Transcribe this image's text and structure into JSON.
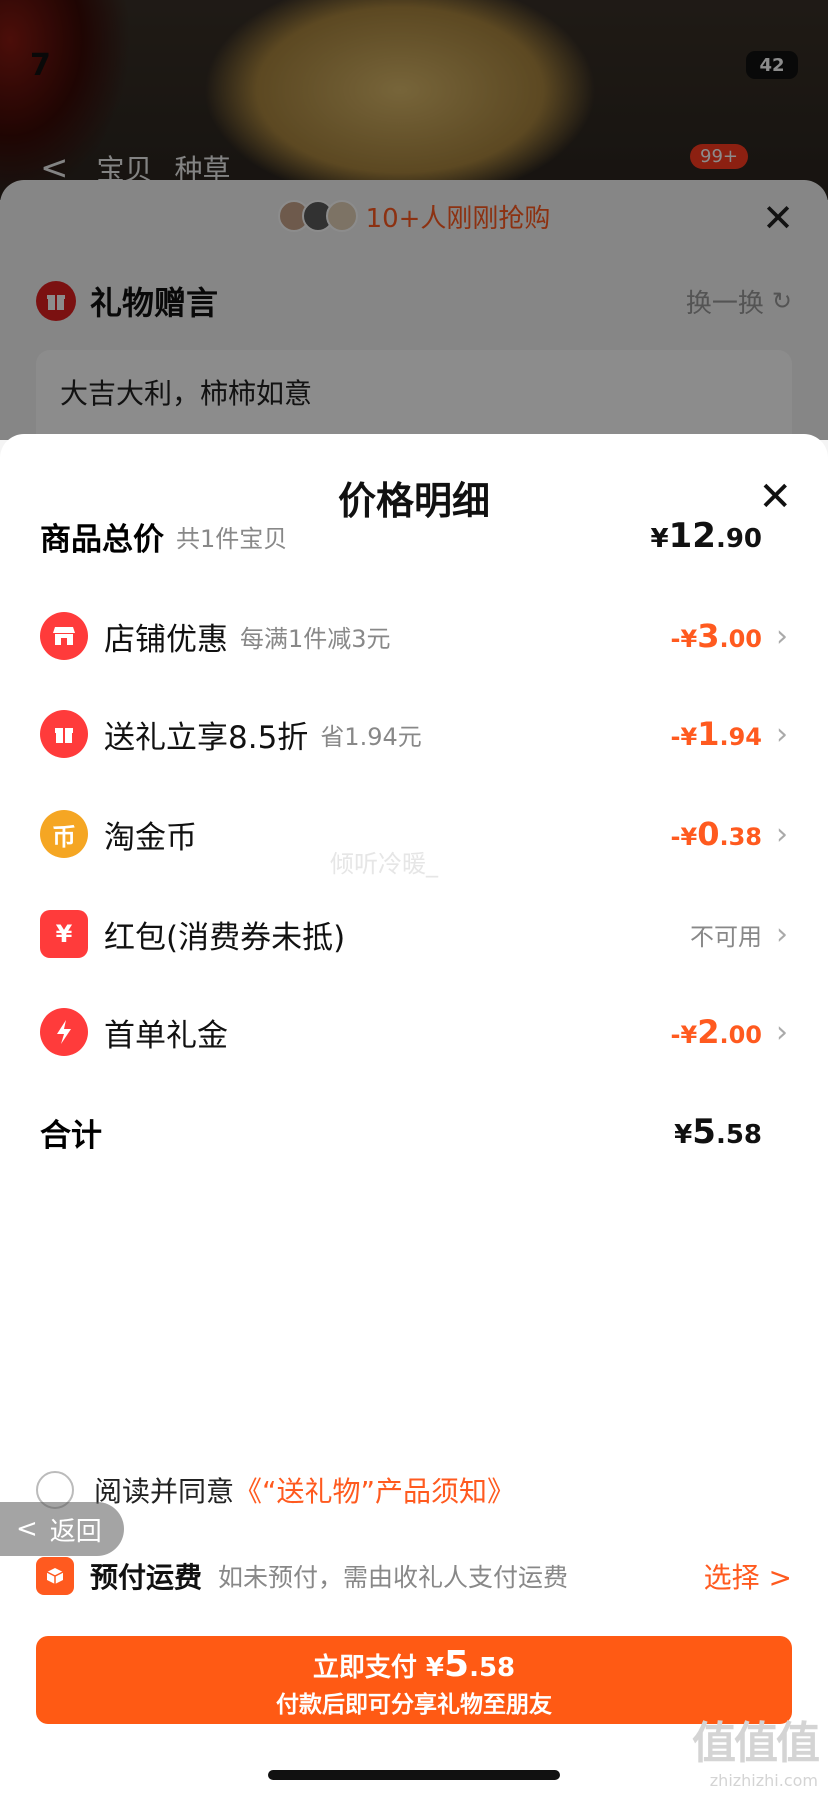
{
  "background": {
    "status_time": "7",
    "battery": "42",
    "nav": {
      "back": "<",
      "tabs": [
        "宝贝",
        "种草"
      ],
      "cart_badge": "99+"
    }
  },
  "gift_sheet": {
    "buyers_text": "10+人刚刚抢购",
    "close": "✕",
    "gift_title": "礼物赠言",
    "swap_label": "换一换",
    "message": "大吉大利，柿柿如意"
  },
  "price_detail": {
    "title": "价格明细",
    "close": "✕",
    "total": {
      "label": "商品总价",
      "sub": "共1件宝贝",
      "currency": "¥",
      "int": "12",
      "dec": ".90"
    },
    "rows": [
      {
        "icon": "store-icon",
        "name": "店铺优惠",
        "sub": "每满1件减3元",
        "sign": "-¥",
        "int": "3",
        "dec": ".00",
        "color": "#ff3b3b"
      },
      {
        "icon": "gift-icon",
        "name": "送礼立享8.5折",
        "sub": "省1.94元",
        "sign": "-¥",
        "int": "1",
        "dec": ".94",
        "color": "#ff3b3b"
      },
      {
        "icon": "coin-icon",
        "name": "淘金币",
        "sub": "",
        "sign": "-¥",
        "int": "0",
        "dec": ".38",
        "color": "#f5a623"
      },
      {
        "icon": "red-packet-icon",
        "name": "红包(消费券未抵)",
        "sub": "",
        "status": "不可用",
        "color": "#ff3b3b"
      },
      {
        "icon": "lightning-icon",
        "name": "首单礼金",
        "sub": "",
        "sign": "-¥",
        "int": "2",
        "dec": ".00",
        "color": "#ff3b3b"
      }
    ],
    "sum": {
      "label": "合计",
      "currency": "¥",
      "int": "5",
      "dec": ".58"
    },
    "watermark": "倾听冷暖_"
  },
  "agreement": {
    "prefix": "阅读并同意",
    "link": "《“送礼物”产品须知》"
  },
  "back_pill": {
    "label": "返回",
    "arrow": "<"
  },
  "shipping": {
    "label": "预付运费",
    "hint": "如未预付，需由收礼人支付运费",
    "action": "选择 >"
  },
  "pay_button": {
    "prefix": "立即支付 ",
    "currency": "¥",
    "int": "5",
    "dec": ".58",
    "subline": "付款后即可分享礼物至朋友"
  },
  "site_mark": {
    "zh": "值值值",
    "en": "zhizhizhi.com"
  }
}
